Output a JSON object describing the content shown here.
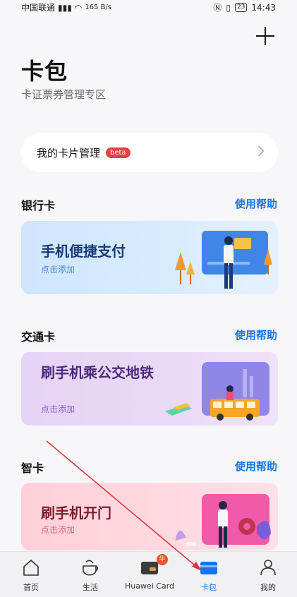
{
  "status_bar": {
    "carrier": "中国联通",
    "speed": "165 B/s",
    "battery": "23",
    "time": "14:43"
  },
  "header": {
    "title": "卡包",
    "subtitle": "卡证票券管理专区"
  },
  "manage": {
    "label": "我的卡片管理",
    "badge": "beta"
  },
  "sections": [
    {
      "title": "银行卡",
      "help": "使用帮助",
      "promo_title": "手机便捷支付",
      "promo_sub": "点击添加"
    },
    {
      "title": "交通卡",
      "help": "使用帮助",
      "promo_title": "刷手机乘公交地铁",
      "promo_sub": "点击添加"
    },
    {
      "title": "智卡",
      "help": "使用帮助",
      "promo_title": "刷手机开门",
      "promo_sub": "点击添加"
    }
  ],
  "tabs": [
    {
      "label": "首页",
      "icon": "home-icon"
    },
    {
      "label": "生活",
      "icon": "cup-icon"
    },
    {
      "label": "Huawei Card",
      "icon": "card-icon",
      "badge": "牛"
    },
    {
      "label": "卡包",
      "icon": "wallet-icon",
      "active": true
    },
    {
      "label": "我的",
      "icon": "person-icon"
    }
  ],
  "colors": {
    "accent": "#1a73e8",
    "beta_badge": "#e84040",
    "annotation_arrow": "#d23a3a"
  }
}
